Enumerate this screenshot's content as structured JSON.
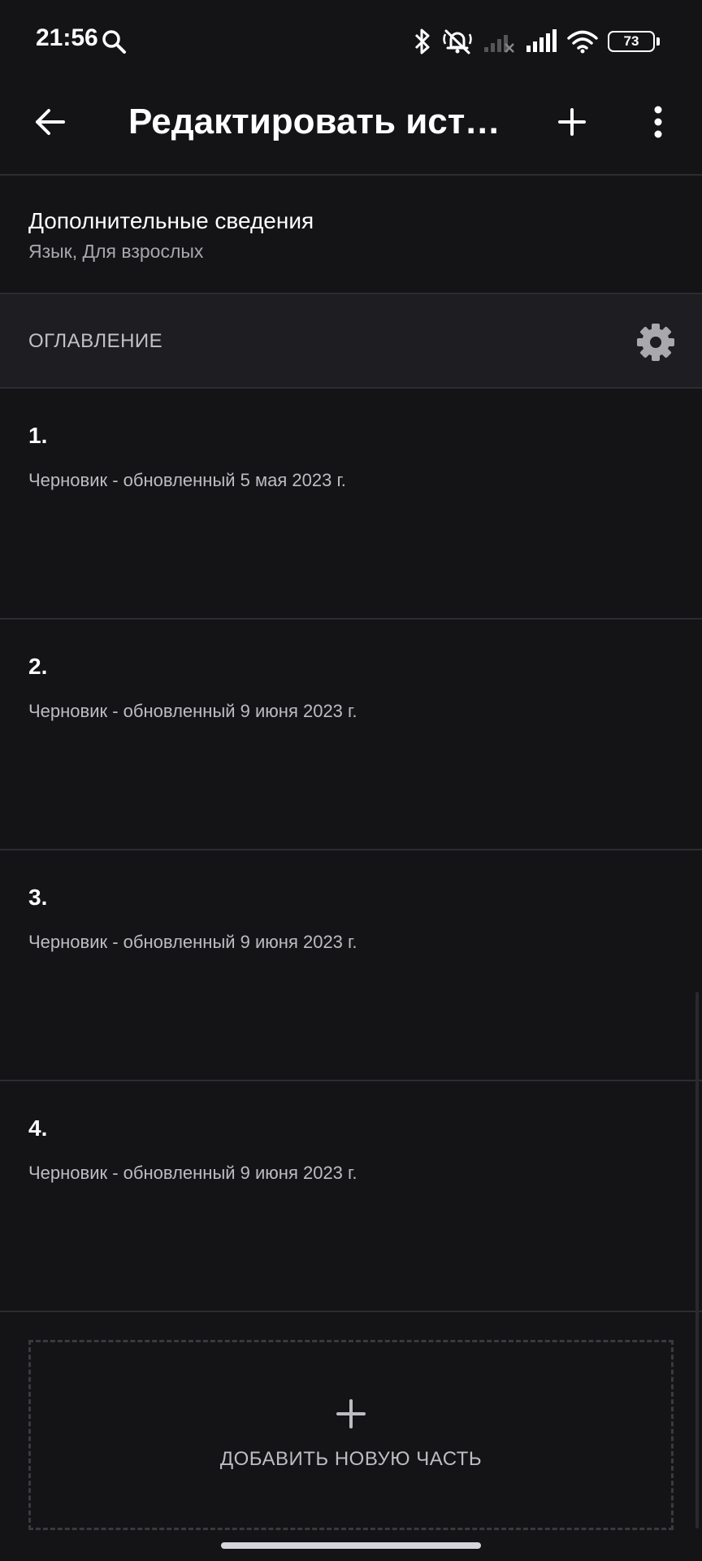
{
  "status_bar": {
    "time": "21:56",
    "battery": "73",
    "icons": [
      "search-icon",
      "bluetooth-icon",
      "mute-bell-icon",
      "signal-1-icon",
      "signal-2-icon",
      "wifi-icon",
      "battery-icon"
    ]
  },
  "app_bar": {
    "title": "Редактировать исто...",
    "icons": [
      "arrow-left-icon",
      "plus-icon",
      "more-vertical-icon"
    ]
  },
  "details": {
    "title": "Дополнительные сведения",
    "subtitle": "Язык, Для взрослых"
  },
  "toc": {
    "label": "ОГЛАВЛЕНИЕ",
    "icon": "gear-icon"
  },
  "chapters": [
    {
      "number": "1.",
      "status": "Черновик - обновленный 5 мая 2023 г."
    },
    {
      "number": "2.",
      "status": "Черновик - обновленный 9 июня 2023 г."
    },
    {
      "number": "3.",
      "status": "Черновик - обновленный 9 июня 2023 г."
    },
    {
      "number": "4.",
      "status": "Черновик - обновленный 9 июня 2023 г."
    }
  ],
  "add_part": {
    "label": "ДОБАВИТЬ НОВУЮ ЧАСТЬ",
    "icon": "plus-icon"
  },
  "colors": {
    "background": "#141316",
    "toc_header_bg": "#1e1d21",
    "divider": "#2d2c30",
    "text_primary": "#ffffff",
    "text_secondary": "#bdbcc1"
  }
}
